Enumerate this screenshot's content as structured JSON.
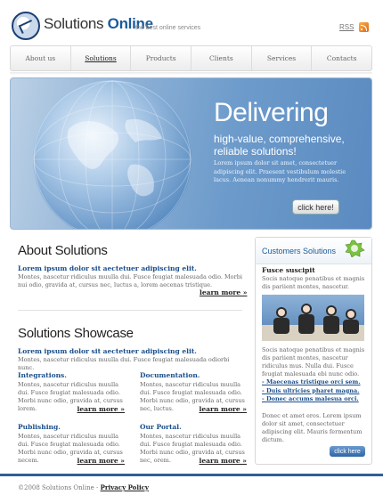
{
  "header": {
    "logo_part1": "Solutions ",
    "logo_part2": "Online",
    "tagline": "the best online services",
    "rss": "RSS"
  },
  "nav": [
    "About us",
    "Solutions",
    "Products",
    "Clients",
    "Services",
    "Contacts"
  ],
  "nav_active": "Solutions",
  "banner": {
    "title": "Delivering",
    "subtitle": "high-value, comprehensive, reliable solutions!",
    "text": "Lorem ipsum dolor sit amet, consectetuer adipiscing elit. Praesent vestibulum molestie lacus. Aenean nonummy hendrerit mauris.",
    "button": "click here!"
  },
  "about": {
    "title_bold": "About",
    "title_rest": " Solutions",
    "lead": "Lorem ipsum dolor sit aectetuer adipiscing elit.",
    "text": "Montes, nascetur ridiculus muulla dui. Fusce feugiat malesuada odio. Morbi nui odio, gravida at, cursus nec, luctus a, lorem aecenas tristique.",
    "more": "learn more »"
  },
  "showcase": {
    "title_bold": "Solutions",
    "title_rest": " Showcase",
    "lead": "Lorem ipsum dolor sit aectetuer adipiscing elit.",
    "text": "Montes, nascetur ridiculus muulla dui. Fusce feugiat malesuada odiorbi nunc.",
    "columns": [
      {
        "title": "Integrations.",
        "text": "Montes, nascetur ridiculus muulla dui. Fusce feugiat malesuada odio. Morbi nunc odio, gravida at, cursus lorem.",
        "more": "learn more »"
      },
      {
        "title": "Documentation.",
        "text": "Montes, nascetur ridiculus muulla dui. Fusce feugiat malesuada odio. Morbi nunc odio, gravida at, cursus nec, luctus.",
        "more": "learn more »"
      },
      {
        "title": "Publishing.",
        "text": "Montes, nascetur ridiculus muulla dui. Fusce feugiat malesuada odio. Morbi nunc odio, gravida at, cursus necem.",
        "more": "learn more »"
      },
      {
        "title": "Our Portal.",
        "text": "Montes, nascetur ridiculus muulla dui. Fusce feugiat malesuada odio. Morbi nunc odio, gravida at, cursus nec, orem.",
        "more": "learn more »"
      }
    ]
  },
  "sidebar": {
    "title": "Customers Solutions",
    "sub": "Fusce suscipit",
    "text1": "Socis natoque penatibus et magnis dis pariient montes, nascetur.",
    "text2": "Socis natoque penatibus et magnis dis pariient montes, nascetur ridiculus mus. Nulla dui. Fusce feugiat malesuada ebi nunc odio.",
    "links": [
      "Maecenas tristique orci sem.",
      "Duis ultricies pharet magna.",
      "Donec accums malesua orci."
    ],
    "text3": "Donec et amet eros. Lorem ipsum dolor sit amet, consectetuer adipiscing elit. Mauris fermentum dictum.",
    "button": "click here"
  },
  "footer": {
    "copyright": "©2008 Solutions Online - ",
    "policy": "Privacy Policy"
  },
  "colors": {
    "accent": "#1a4e8a",
    "brand": "#1a5c9a",
    "footer_bar": "#2e5f96"
  }
}
